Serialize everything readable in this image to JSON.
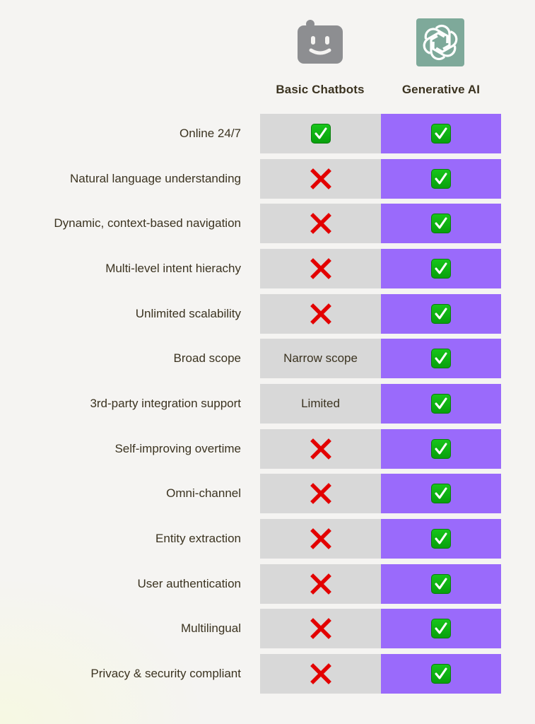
{
  "columns": {
    "basic": {
      "title": "Basic Chatbots",
      "icon": "robot-face-icon",
      "icon_color": "#8d8e91",
      "cell_color": "#d8d8d8"
    },
    "generative": {
      "title": "Generative AI",
      "icon": "openai-logo-icon",
      "icon_color": "#7ea99a",
      "cell_color": "#9a6afb"
    }
  },
  "rows": [
    {
      "feature": "Online 24/7",
      "basic": {
        "type": "check"
      },
      "generative": {
        "type": "check"
      }
    },
    {
      "feature": "Natural language understanding",
      "basic": {
        "type": "cross"
      },
      "generative": {
        "type": "check"
      }
    },
    {
      "feature": "Dynamic, context-based navigation",
      "basic": {
        "type": "cross"
      },
      "generative": {
        "type": "check"
      }
    },
    {
      "feature": "Multi-level intent hierachy",
      "basic": {
        "type": "cross"
      },
      "generative": {
        "type": "check"
      }
    },
    {
      "feature": "Unlimited scalability",
      "basic": {
        "type": "cross"
      },
      "generative": {
        "type": "check"
      }
    },
    {
      "feature": "Broad scope",
      "basic": {
        "type": "text",
        "text": "Narrow scope"
      },
      "generative": {
        "type": "check"
      }
    },
    {
      "feature": "3rd-party integration support",
      "basic": {
        "type": "text",
        "text": "Limited"
      },
      "generative": {
        "type": "check"
      }
    },
    {
      "feature": "Self-improving overtime",
      "basic": {
        "type": "cross"
      },
      "generative": {
        "type": "check"
      }
    },
    {
      "feature": "Omni-channel",
      "basic": {
        "type": "cross"
      },
      "generative": {
        "type": "check"
      }
    },
    {
      "feature": "Entity extraction",
      "basic": {
        "type": "cross"
      },
      "generative": {
        "type": "check"
      }
    },
    {
      "feature": "User authentication",
      "basic": {
        "type": "cross"
      },
      "generative": {
        "type": "check"
      }
    },
    {
      "feature": "Multilingual",
      "basic": {
        "type": "cross"
      },
      "generative": {
        "type": "check"
      }
    },
    {
      "feature": "Privacy & security compliant",
      "basic": {
        "type": "cross"
      },
      "generative": {
        "type": "check"
      }
    }
  ]
}
